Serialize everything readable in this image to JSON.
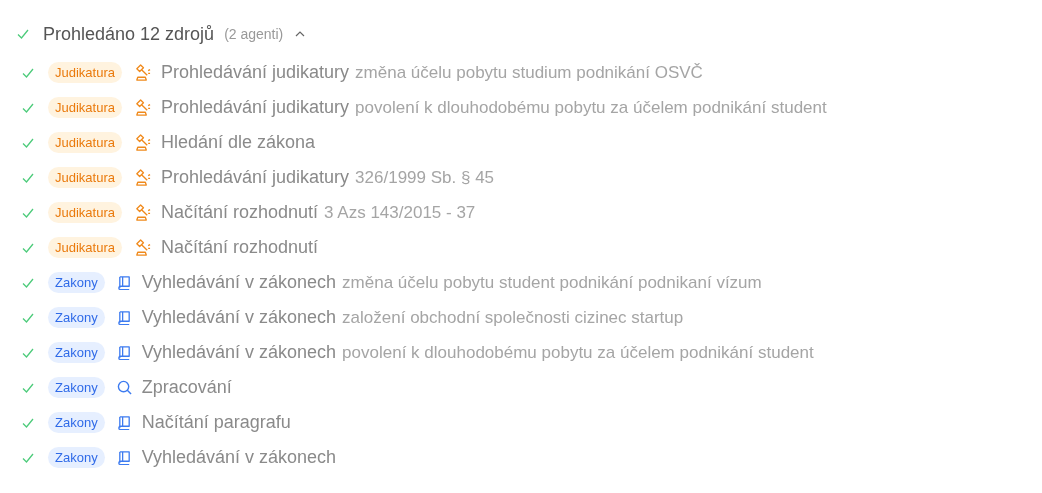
{
  "header": {
    "title": "Prohledáno 12 zdrojů",
    "agents": "(2 agenti)",
    "expanded": true
  },
  "steps": [
    {
      "done": true,
      "tag": "Judikatura",
      "kind": "judikatura",
      "action": "Prohledávání judikatury",
      "query": "změna účelu pobytu studium podnikání OSVČ"
    },
    {
      "done": true,
      "tag": "Judikatura",
      "kind": "judikatura",
      "action": "Prohledávání judikatury",
      "query": "povolení k dlouhodobému pobytu za účelem podnikání student"
    },
    {
      "done": true,
      "tag": "Judikatura",
      "kind": "judikatura",
      "action": "Hledání dle zákona"
    },
    {
      "done": true,
      "tag": "Judikatura",
      "kind": "judikatura",
      "action": "Prohledávání judikatury",
      "query": "326/1999 Sb. § 45"
    },
    {
      "done": true,
      "tag": "Judikatura",
      "kind": "judikatura",
      "action": "Načítání rozhodnutí",
      "query": "3 Azs 143/2015 - 37"
    },
    {
      "done": true,
      "tag": "Judikatura",
      "kind": "judikatura",
      "action": "Načítání rozhodnutí"
    },
    {
      "done": true,
      "tag": "Zakony",
      "kind": "zakony",
      "action": "Vyhledávání v zákonech",
      "query": "změna účelu pobytu student podnikání podnikaní vízum"
    },
    {
      "done": true,
      "tag": "Zakony",
      "kind": "zakony",
      "action": "Vyhledávání v zákonech",
      "query": "založení obchodní společnosti cizinec startup"
    },
    {
      "done": true,
      "tag": "Zakony",
      "kind": "zakony",
      "action": "Vyhledávání v zákonech",
      "query": "povolení k dlouhodobému pobytu za účelem podnikání student"
    },
    {
      "done": true,
      "tag": "Zakony",
      "kind": "processing",
      "action": "Zpracování"
    },
    {
      "done": true,
      "tag": "Zakony",
      "kind": "zakony",
      "action": "Načítání paragrafu"
    },
    {
      "done": true,
      "tag": "Zakony",
      "kind": "zakony",
      "action": "Vyhledávání v zákonech"
    }
  ]
}
